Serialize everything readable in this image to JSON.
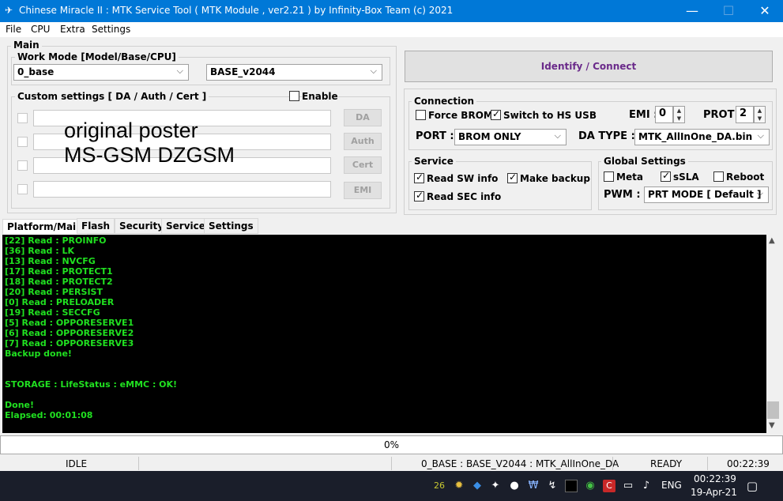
{
  "window": {
    "title": "Chinese Miracle II : MTK Service Tool ( MTK Module , ver2.21 ) by Infinity-Box Team (c) 2021"
  },
  "menu": [
    "File",
    "CPU",
    "Extra",
    "Settings"
  ],
  "main": {
    "label": "Main",
    "work_mode_label": "Work Mode [Model/Base/CPU]",
    "model_value": "0_base",
    "base_value": "BASE_v2044",
    "custom_label": "Custom settings [ DA / Auth / Cert ]",
    "enable_label": "Enable",
    "buttons": [
      "DA",
      "Auth",
      "Cert",
      "EMI"
    ],
    "watermark": [
      "original poster",
      "MS-GSM DZGSM"
    ]
  },
  "identify_button": "Identify / Connect",
  "connection": {
    "label": "Connection",
    "force_brom": "Force BROM",
    "switch_hs": "Switch to HS USB",
    "emi_label": "EMI :",
    "emi_value": "0",
    "prot_label": "PROT :",
    "prot_value": "2",
    "port_label": "PORT :",
    "port_value": "BROM ONLY",
    "datype_label": "DA TYPE :",
    "datype_value": "MTK_AllInOne_DA.bin"
  },
  "service": {
    "label": "Service",
    "read_sw": "Read SW info",
    "make_backup": "Make backup",
    "read_sec": "Read SEC info"
  },
  "global": {
    "label": "Global Settings",
    "meta": "Meta",
    "ssla": "sSLA",
    "reboot": "Reboot",
    "pwm_label": "PWM :",
    "pwm_value": "PRT MODE [ Default ]"
  },
  "tabs": [
    "Platform/Main",
    "Flash",
    "Security",
    "Service",
    "Settings"
  ],
  "log": [
    "[22] Read : PROINFO",
    "[36] Read : LK",
    "[13] Read : NVCFG",
    "[17] Read : PROTECT1",
    "[18] Read : PROTECT2",
    "[20] Read : PERSIST",
    "[0] Read : PRELOADER",
    "[19] Read : SECCFG",
    "[5] Read : OPPORESERVE1",
    "[6] Read : OPPORESERVE2",
    "[7] Read : OPPORESERVE3",
    "Backup done!",
    "",
    "",
    "STORAGE : LifeStatus : eMMC : OK!",
    "",
    "Done!",
    "Elapsed: 00:01:08"
  ],
  "progress": "0%",
  "status": {
    "state": "IDLE",
    "info": "0_BASE : BASE_V2044 : MTK_AllInOne_DA",
    "ready": "READY",
    "time": "00:22:39"
  },
  "taskbar": {
    "badge": "26",
    "lang": "ENG",
    "time": "00:22:39",
    "date": "19-Apr-21"
  },
  "colors": {
    "titlebar": "#0078d7",
    "log_bg": "#000000",
    "log_text": "#20e020",
    "identify_text": "#6a2a8a"
  }
}
